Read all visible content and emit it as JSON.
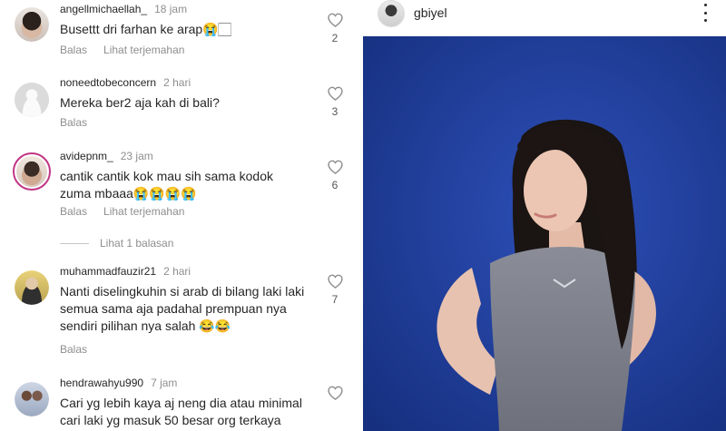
{
  "comments": [
    {
      "username": "angellmichaellah_",
      "time": "18 jam",
      "text": "Busettt dri farhan ke arap😭🏻",
      "reply": "Balas",
      "translate": "Lihat terjemahan",
      "likes": "2"
    },
    {
      "username": "noneedtobeconcern",
      "time": "2 hari",
      "text": "Mereka ber2 aja kah di bali?",
      "reply": "Balas",
      "likes": "3"
    },
    {
      "username": "avidepnm_",
      "time": "23 jam",
      "text": "cantik cantik kok mau sih sama kodok\nzuma mbaaa😭😭😭😭",
      "reply": "Balas",
      "translate": "Lihat terjemahan",
      "likes": "6"
    },
    {
      "username": "muhammadfauzir21",
      "time": "2 hari",
      "text": "Nanti diselingkuhin si arab di bilang laki laki\nsemua sama aja padahal prempuan nya\nsendiri pilihan nya salah 😂😂",
      "reply": "Balas",
      "likes": "7"
    },
    {
      "username": "hendrawahyu990",
      "time": "7 jam",
      "text": "Cari yg lebih kaya aj neng dia atau minimal\ncari laki yg masuk 50 besar org terkaya"
    }
  ],
  "view_replies": "Lihat 1 balasan",
  "post": {
    "username": "gbiyel"
  },
  "colors": {
    "photo_background": "#1f3d9a",
    "meta_text": "#8e8e8e",
    "story_ring": "#c13584"
  }
}
